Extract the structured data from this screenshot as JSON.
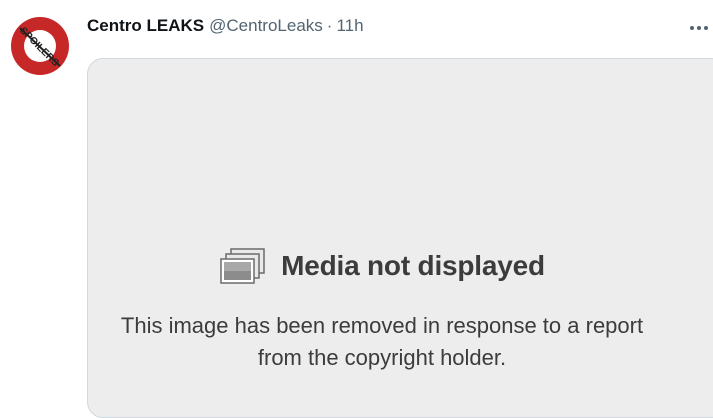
{
  "tweet": {
    "author": {
      "display_name": "Centro LEAKS",
      "handle": "@CentroLeaks",
      "avatar_text": "SPOILERS"
    },
    "separator": "·",
    "time": "11h",
    "more_icon": "more-horizontal-icon"
  },
  "media": {
    "icon": "media-photo-stack-icon",
    "title": "Media not displayed",
    "message": "This image has been removed in response to a report from the copyright holder."
  },
  "colors": {
    "text_primary": "#0f1419",
    "text_secondary": "#536471",
    "media_bg": "#ededed",
    "avatar_red": "#c62828"
  }
}
